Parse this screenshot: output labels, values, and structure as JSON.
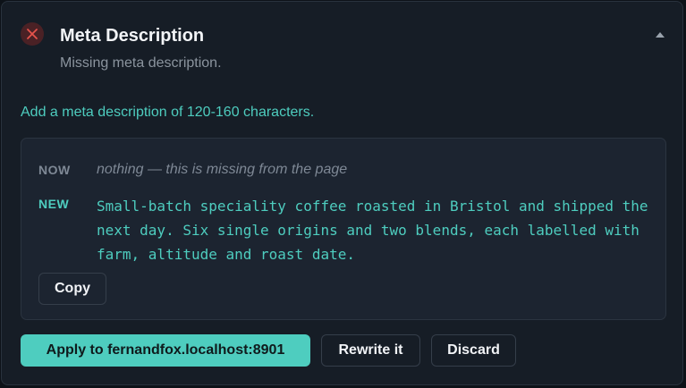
{
  "audit": {
    "status": "fail",
    "status_color": "#e5534b",
    "status_icon": "close-icon",
    "title": "Meta Description",
    "subtitle": "Missing meta description.",
    "recommendation": "Add a meta description of 120-160 characters.",
    "accent_color": "#4ecdbf"
  },
  "compare": {
    "now_label": "NOW",
    "now_value": "nothing — this is missing from the page",
    "new_label": "NEW",
    "new_value": "Small-batch speciality coffee roasted in Bristol and shipped the next day. Six single origins and two blends, each labelled with farm, altitude and roast date.",
    "copy_label": "Copy"
  },
  "actions": {
    "apply_label": "Apply to fernandfox.localhost:8901",
    "rewrite_label": "Rewrite it",
    "discard_label": "Discard"
  }
}
